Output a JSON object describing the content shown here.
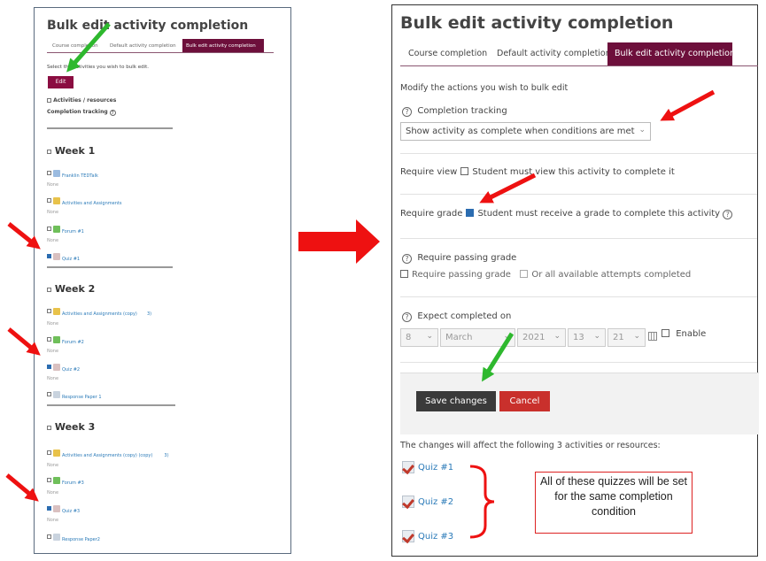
{
  "left_page": {
    "title": "Bulk edit activity completion",
    "tabs": [
      "Course completion",
      "Default activity completion",
      "Bulk edit activity completion"
    ],
    "instruction": "Select the activities you wish to bulk edit.",
    "edit_label": "Edit",
    "select_all_label": "Activities / resources",
    "completion_tracking_label": "Completion tracking",
    "weeks": [
      {
        "title": "Week 1",
        "items": [
          {
            "name": "Franklin TEDTalk",
            "checked": false,
            "status": "None",
            "icon": "page-icon"
          },
          {
            "name": "Activities and Assignments",
            "checked": false,
            "status": "None",
            "icon": "label-icon"
          },
          {
            "name": "Forum #1",
            "checked": false,
            "status": "None",
            "icon": "forum-icon"
          },
          {
            "name": "Quiz #1",
            "checked": true,
            "status": "",
            "icon": "quiz-icon"
          }
        ]
      },
      {
        "title": "Week 2",
        "items": [
          {
            "name": "Activities and Assignments (copy)",
            "checked": false,
            "status": "None",
            "icon": "label-icon"
          },
          {
            "name": "Forum #2",
            "checked": false,
            "status": "None",
            "icon": "forum-icon"
          },
          {
            "name": "Quiz #2",
            "checked": true,
            "status": "None",
            "icon": "quiz-icon"
          },
          {
            "name": "Response Paper 1",
            "checked": false,
            "status": "",
            "icon": "assignment-icon"
          }
        ]
      },
      {
        "title": "Week 3",
        "items": [
          {
            "name": "Activities and Assignments (copy) (copy)",
            "checked": false,
            "status": "None",
            "icon": "label-icon"
          },
          {
            "name": "Forum #3",
            "checked": false,
            "status": "None",
            "icon": "forum-icon"
          },
          {
            "name": "Quiz #3",
            "checked": true,
            "status": "None",
            "icon": "quiz-icon"
          },
          {
            "name": "Response Paper2",
            "checked": false,
            "status": "",
            "icon": "assignment-icon"
          }
        ]
      }
    ],
    "stray": "3)"
  },
  "right_page": {
    "title": "Bulk edit activity completion",
    "tabs": [
      "Course completion",
      "Default activity completion",
      "Bulk edit activity completion"
    ],
    "active_tab": 2,
    "instruction": "Modify the actions you wish to bulk edit",
    "completion_tracking_label": "Completion tracking",
    "completion_tracking_value": "Show activity as complete when conditions are met",
    "require_view_label": "Require view",
    "require_view_text": "Student must view this activity to complete it",
    "require_view_checked": false,
    "require_grade_label": "Require grade",
    "require_grade_text": "Student must receive a grade to complete this activity",
    "require_grade_checked": true,
    "require_passing_grade_heading": "Require passing grade",
    "require_passing_grade_label": "Require passing grade",
    "all_attempts_label": "Or all available attempts completed",
    "expect_completed_label": "Expect completed on",
    "date": {
      "day": "8",
      "month": "March",
      "year": "2021",
      "hour": "13",
      "minute": "21"
    },
    "enable_label": "Enable",
    "save_label": "Save changes",
    "cancel_label": "Cancel",
    "changes_text": "The changes will affect the following 3 activities or resources:",
    "affected": [
      "Quiz #1",
      "Quiz #2",
      "Quiz #3"
    ]
  },
  "callout": "All of these quizzes will be set for the same completion condition",
  "colors": {
    "brand": "#6d0f3b",
    "save": "#3a3a3a",
    "cancel": "#c9302c",
    "arrow_red": "#ee1111",
    "arrow_green": "#2eb82e",
    "link": "#2a7ab8"
  }
}
